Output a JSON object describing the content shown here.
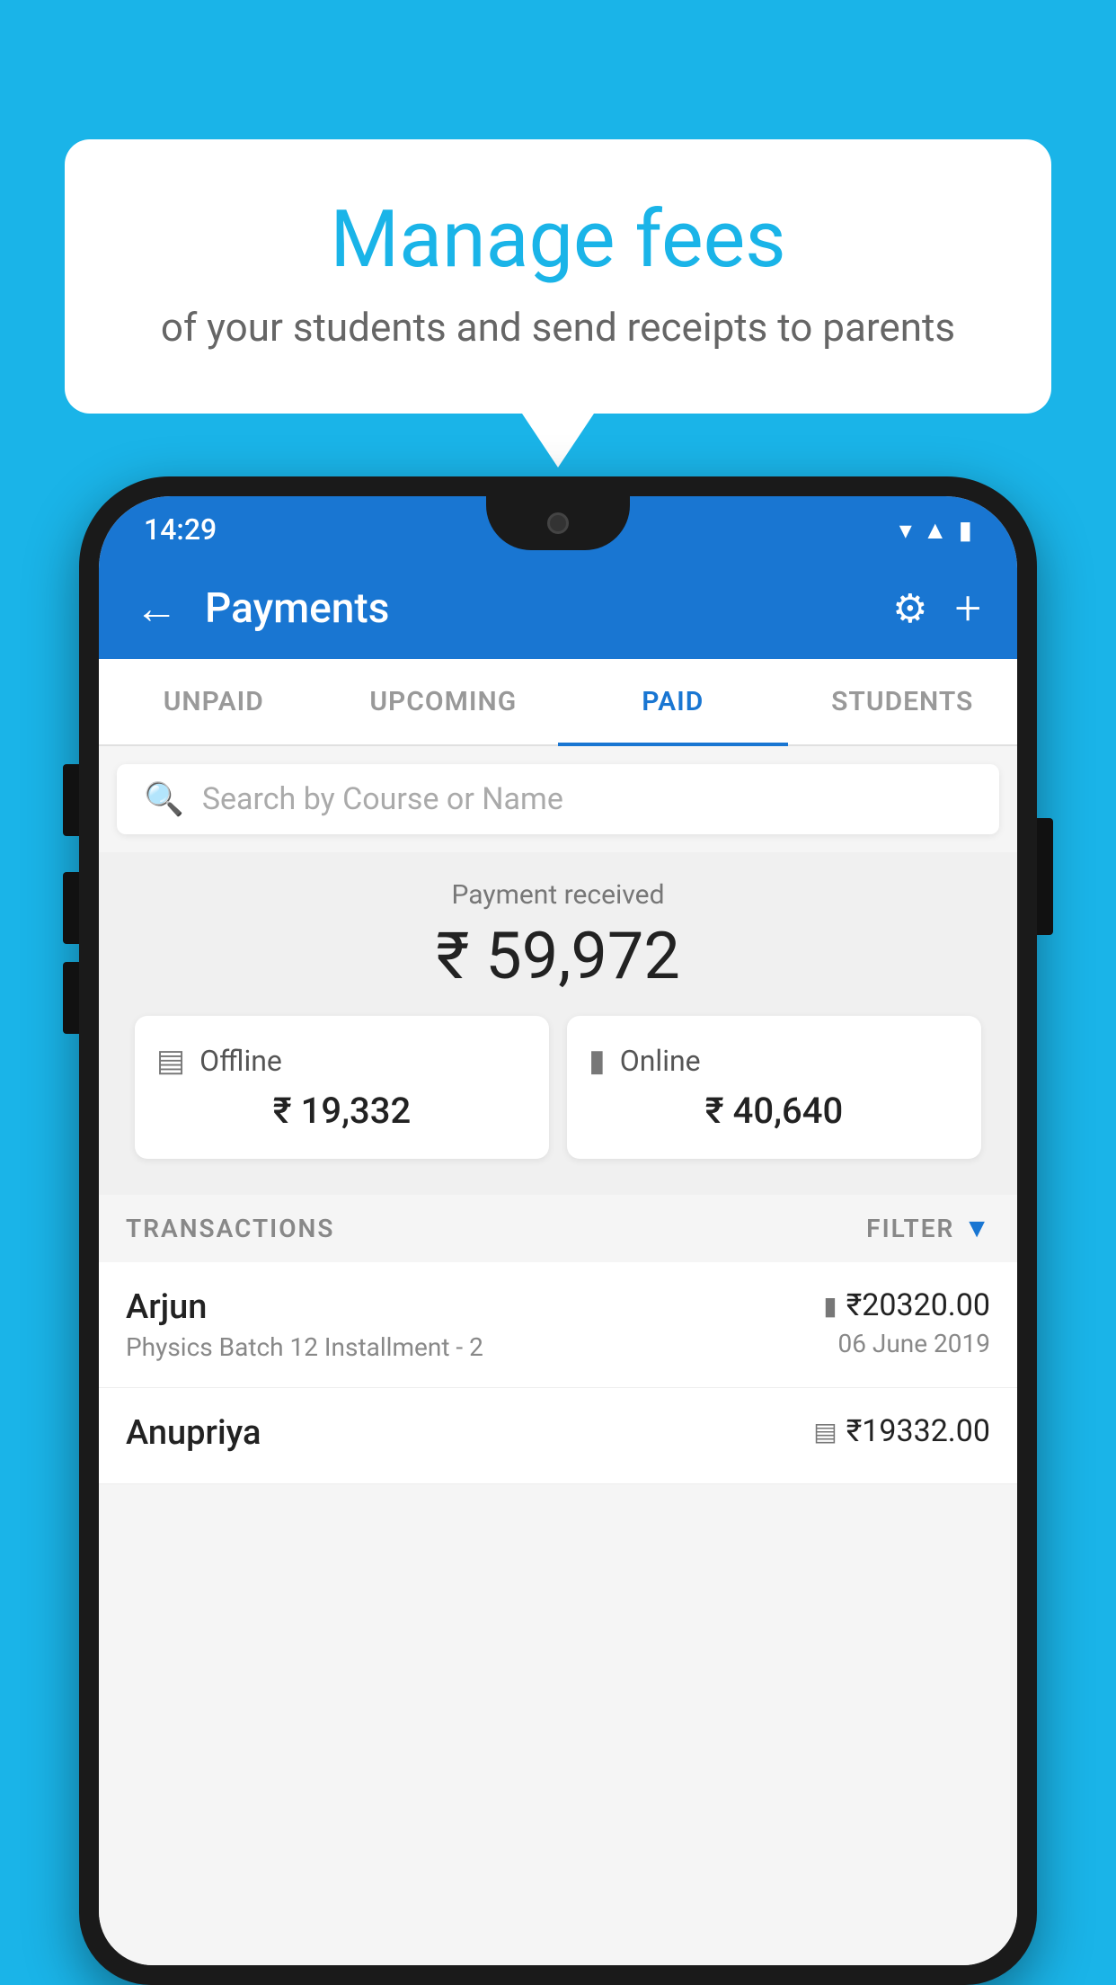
{
  "background_color": "#1ab4e8",
  "speech_bubble": {
    "title": "Manage fees",
    "subtitle": "of your students and send receipts to parents"
  },
  "status_bar": {
    "time": "14:29",
    "icons": [
      "wifi",
      "signal",
      "battery"
    ]
  },
  "app_bar": {
    "title": "Payments",
    "back_icon": "←",
    "gear_icon": "⚙",
    "plus_icon": "+"
  },
  "tabs": [
    {
      "label": "UNPAID",
      "active": false
    },
    {
      "label": "UPCOMING",
      "active": false
    },
    {
      "label": "PAID",
      "active": true
    },
    {
      "label": "STUDENTS",
      "active": false
    }
  ],
  "search": {
    "placeholder": "Search by Course or Name"
  },
  "payment_summary": {
    "label": "Payment received",
    "total_amount": "₹ 59,972",
    "offline": {
      "label": "Offline",
      "amount": "₹ 19,332"
    },
    "online": {
      "label": "Online",
      "amount": "₹ 40,640"
    }
  },
  "transactions_section": {
    "label": "TRANSACTIONS",
    "filter_label": "FILTER"
  },
  "transactions": [
    {
      "name": "Arjun",
      "description": "Physics Batch 12 Installment - 2",
      "amount": "₹20320.00",
      "date": "06 June 2019",
      "payment_type": "card"
    },
    {
      "name": "Anupriya",
      "description": "",
      "amount": "₹19332.00",
      "date": "",
      "payment_type": "offline"
    }
  ]
}
